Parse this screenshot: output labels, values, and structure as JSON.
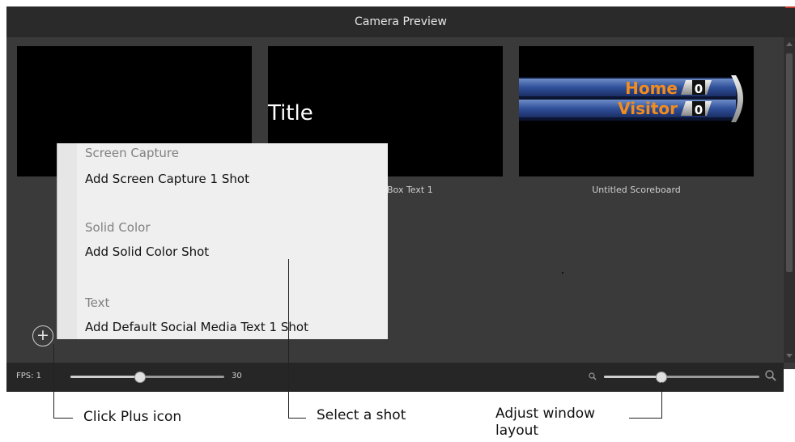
{
  "window": {
    "title": "Camera Preview"
  },
  "shots": [
    {
      "label": ""
    },
    {
      "label": "Box Text 1",
      "preview_text": "Title"
    },
    {
      "label": "Untitled Scoreboard",
      "home": "Home",
      "visitor": "Visitor",
      "home_score": "0",
      "visitor_score": "0"
    }
  ],
  "menu": {
    "sections": [
      {
        "heading": "Screen Capture",
        "item": "Add Screen Capture 1 Shot"
      },
      {
        "heading": "Solid Color",
        "item": "Add Solid Color Shot"
      },
      {
        "heading": "Text",
        "item": "Add Default Social Media Text 1 Shot"
      }
    ]
  },
  "footer": {
    "fps_label": "FPS: 1",
    "fps_max": "30",
    "fps_fraction": 0.45,
    "zoom_fraction": 0.37
  },
  "annotations": {
    "plus": "Click Plus icon",
    "shot": "Select a shot",
    "layout_line1": "Adjust window",
    "layout_line2": "layout"
  },
  "colors": {
    "app_bg": "#3a3a3a",
    "titlebar_bg": "#2a2a2a",
    "menu_bg": "#efefef"
  },
  "icons": [
    "plus-icon",
    "zoom-out-icon",
    "zoom-in-icon"
  ]
}
